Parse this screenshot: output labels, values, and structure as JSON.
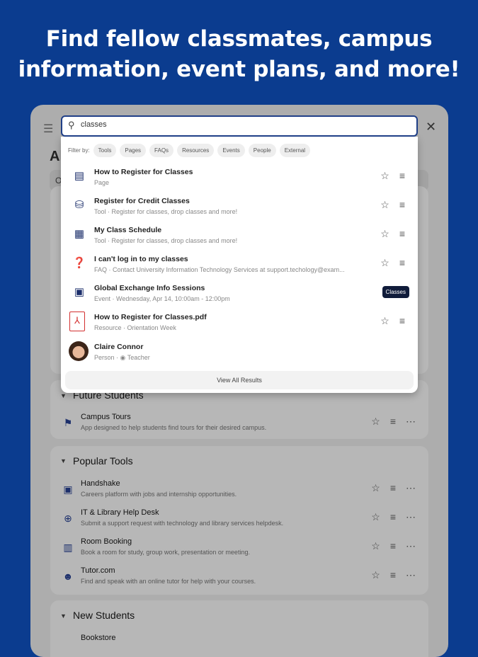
{
  "headline": [
    "Find fellow classmates, campus",
    "information, event plans, and more!"
  ],
  "background": {
    "title": "Al",
    "filter": "O"
  },
  "search": {
    "value": "classes"
  },
  "filters": {
    "label": "Filter by:",
    "chips": [
      "Tools",
      "Pages",
      "FAQs",
      "Resources",
      "Events",
      "People",
      "External"
    ]
  },
  "results": [
    {
      "title": "How to Register for Classes",
      "sub": "Page",
      "icon": "page-icon"
    },
    {
      "title": "Register for Credit Classes",
      "sub": "Tool · Register for classes, drop classes and more!",
      "icon": "tool-icon"
    },
    {
      "title": "My Class Schedule",
      "sub": "Tool · Register for classes, drop classes and more!",
      "icon": "calendar-icon"
    },
    {
      "title": "I can't log in to my classes",
      "sub": "FAQ · Contact University Information Technology Services at support.techology@exam...",
      "icon": "help-icon"
    },
    {
      "title": "Global Exchange Info Sessions",
      "sub": "Event · Wednesday, Apr 14, 10:00am - 12:00pm",
      "icon": "event-icon",
      "tooltip": "Classes"
    },
    {
      "title": "How to Register for Classes.pdf",
      "sub": "Resource · Orientation Week",
      "icon": "pdf-icon"
    },
    {
      "title": "Claire Connor",
      "sub": "Person · ◉ Teacher",
      "icon": "avatar"
    }
  ],
  "view_all": "View All Results",
  "sections": [
    {
      "title": "Future Students",
      "items": [
        {
          "title": "Campus Tours",
          "desc": "App designed to help students find tours for their desired campus."
        }
      ]
    },
    {
      "title": "Popular Tools",
      "items": [
        {
          "title": "Handshake",
          "desc": "Careers platform with jobs and internship opportunities."
        },
        {
          "title": "IT & Library Help Desk",
          "desc": "Submit a support request with technology and library services helpdesk."
        },
        {
          "title": "Room Booking",
          "desc": "Book a room for study, group work, presentation or meeting."
        },
        {
          "title": "Tutor.com",
          "desc": "Find and speak with an online tutor for help with your courses."
        }
      ]
    },
    {
      "title": "New Students",
      "items": [
        {
          "title": "Bookstore"
        }
      ]
    }
  ]
}
